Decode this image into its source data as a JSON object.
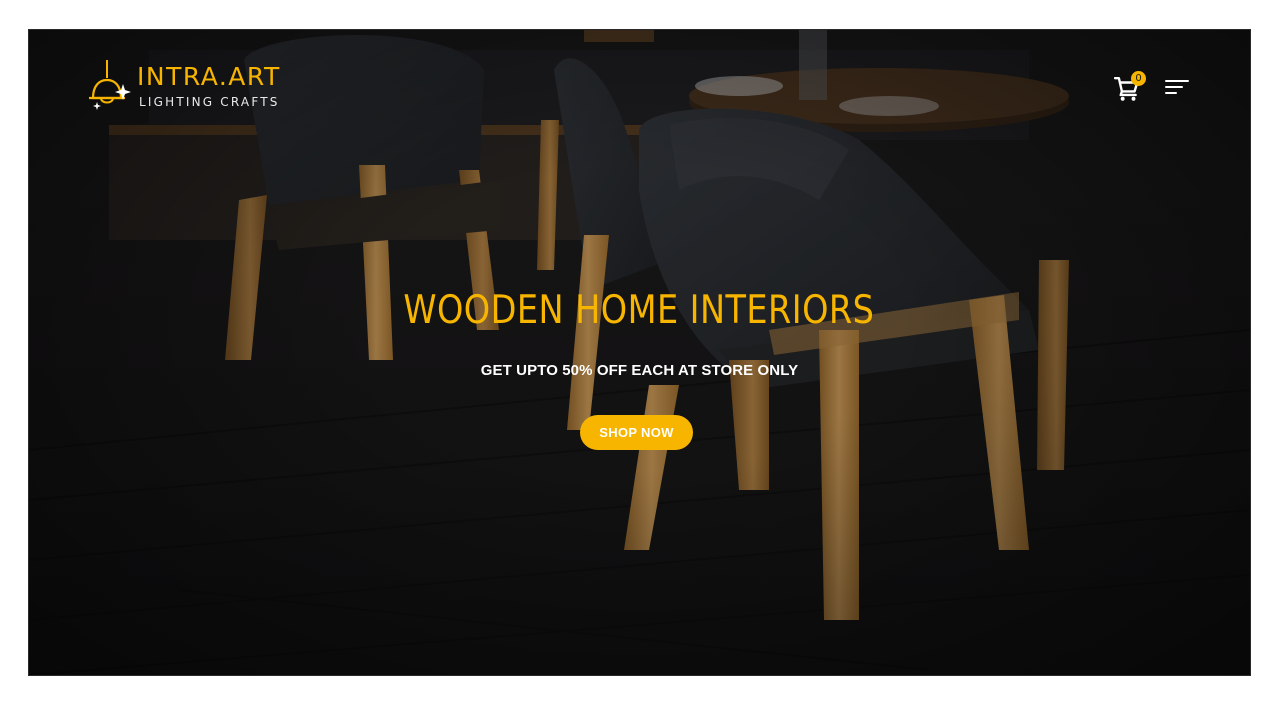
{
  "brand": {
    "name": "INTRA.ART",
    "tagline": "LIGHTING CRAFTS",
    "logo_icon": "pendant-lamp-sparkle-icon"
  },
  "header": {
    "cart_icon": "shopping-cart-icon",
    "cart_count": "0",
    "menu_icon": "hamburger-menu-icon"
  },
  "hero": {
    "headline": "WOODEN HOME INTERIORS",
    "subline": "GET UPTO 50% OFF EACH AT STORE ONLY",
    "cta_label": "SHOP NOW",
    "background_image": "dark restaurant interior with black chairs on wooden legs"
  },
  "colors": {
    "accent": "#f7b500",
    "text_light": "#ffffff",
    "background_dark": "#141414"
  }
}
